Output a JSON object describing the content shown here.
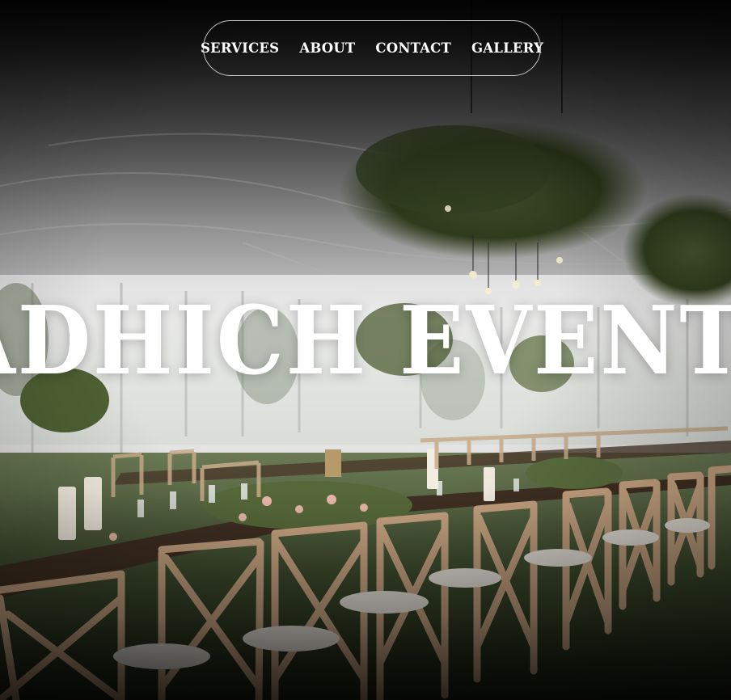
{
  "nav": {
    "items": [
      {
        "label": "SERVICES"
      },
      {
        "label": "ABOUT"
      },
      {
        "label": "CONTACT"
      },
      {
        "label": "GALLERY"
      }
    ]
  },
  "hero": {
    "title": "ADHICH EVENT",
    "background_image": "wedding-tent-reception-photo"
  },
  "colors": {
    "text": "#ffffff",
    "nav_border": "#ffffff",
    "backdrop_top": "#0b0b0b",
    "tent_fabric": "#d9d9d9",
    "chairs": "#c9a582",
    "grass": "#2f3a22"
  }
}
